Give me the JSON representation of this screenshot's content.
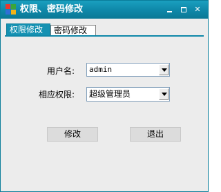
{
  "window": {
    "title": "权限、密码修改",
    "min_symbol": "",
    "max_symbol": "",
    "close_symbol": "✕"
  },
  "tabs": [
    {
      "label": "权限修改",
      "active": true
    },
    {
      "label": "密码修改",
      "active": false
    }
  ],
  "form": {
    "username_label": "用户名:",
    "username_value": "admin",
    "permission_label": "相应权限:",
    "permission_value": "超级管理员"
  },
  "buttons": {
    "modify_label": "修改",
    "exit_label": "退出"
  },
  "colors": {
    "titlebar": "#0e87a8",
    "active_tab": "#1491b2",
    "panel_bg": "#ececec"
  }
}
